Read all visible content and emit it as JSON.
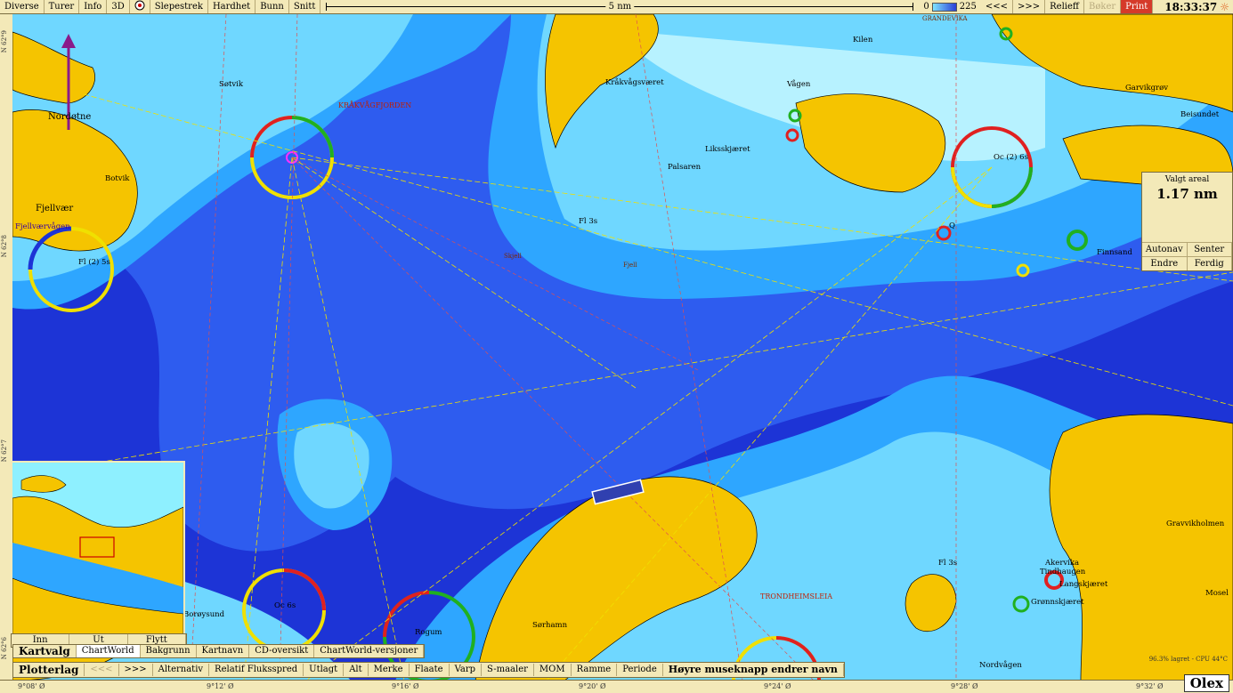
{
  "topbar": {
    "menu": [
      "Diverse",
      "Turer",
      "Info",
      "3D"
    ],
    "menu2": [
      "Slepestrek",
      "Hardhet",
      "Bunn",
      "Snitt"
    ],
    "scale_label": "5 nm",
    "depth_min": "0",
    "depth_max": "225",
    "nav_prev": "<<<",
    "nav_next": ">>>",
    "relief": "Relieff",
    "dim_button": "Bøker",
    "print": "Print",
    "clock": "18:33:37"
  },
  "lat_labels": [
    "N 62°9",
    "N 62°8",
    "N 62°7",
    "N 62°6"
  ],
  "lon_labels": [
    "9°08' Ø",
    "9°12' Ø",
    "9°16' Ø",
    "9°20' Ø",
    "9°24' Ø",
    "9°28' Ø",
    "9°32' Ø"
  ],
  "area_panel": {
    "title": "Valgt areal",
    "value": "1.17 nm",
    "buttons": [
      "Autonav",
      "Senter",
      "Endre",
      "Ferdig"
    ]
  },
  "inset_buttons": [
    "Inn",
    "Ut",
    "Flytt"
  ],
  "chart_row": {
    "heading": "Kartvalg",
    "items": [
      "ChartWorld",
      "Bakgrunn",
      "Kartnavn",
      "CD-oversikt",
      "ChartWorld-versjoner"
    ]
  },
  "layer_row": {
    "heading": "Plotterlag",
    "prev": "<<<",
    "next": ">>>",
    "items": [
      "Alternativ",
      "Relatif Fluksspred",
      "Utlagt",
      "Alt",
      "Merke",
      "Flaate",
      "Varp",
      "S-maaler",
      "MOM",
      "Ramme",
      "Periode"
    ],
    "hint": "Høyre museknapp endrer navn"
  },
  "status": "96.3% lagret - CPU 44°C",
  "brand": "Olex",
  "places": {
    "nordoturn": "Nordøtne",
    "fjellvaer": "Fjellvær",
    "fjellvaervagen": "Fjellværvågen",
    "botvik": "Botvik",
    "krakvagfjorden": "KRÅKVÅGFJORDEN",
    "krakvagsvaeret": "Kråkvågsværet",
    "vagen": "Vågen",
    "kilen": "Kilen",
    "grandevika": "GRANDEVIKA",
    "garvikgrov": "Garvikgrøv",
    "beisundet": "Beisundet",
    "palsaren": "Palsaren",
    "liksskjaeret": "Liksskjæret",
    "skjell": "Skjell",
    "fjell": "Fjell",
    "borovsund": "Borøysund",
    "rogum": "Rogum",
    "sorhamn": "Sørhamn",
    "trondheimsleia": "TRONDHEIMSLEIA",
    "akervika": "Akervika",
    "tindhaugen": "Tindhaugen",
    "langskjaeret": "Langskjæret",
    "gronnskjaeret": "Grønnskjæret",
    "nordvagen": "Nordvågen",
    "gravvikholmen": "Gravvikholmen",
    "mosel": "Mosel",
    "sotvik": "Søtvik",
    "finnsand": "Finnsand"
  },
  "light_labels": {
    "fl2": "Fl (2) 5s",
    "fl3": "Fl 3s",
    "oc2": "Oc (2) 6s",
    "oc6": "Oc 6s",
    "q": "Q",
    "fl3s": "Fl 3s"
  },
  "colors": {
    "land": "#f5c400",
    "deep": "#1d34d6",
    "mid": "#2e5cef",
    "shallow": "#2ea6ff",
    "shoal": "#6fd7ff",
    "vshoal": "#b7f2ff"
  }
}
